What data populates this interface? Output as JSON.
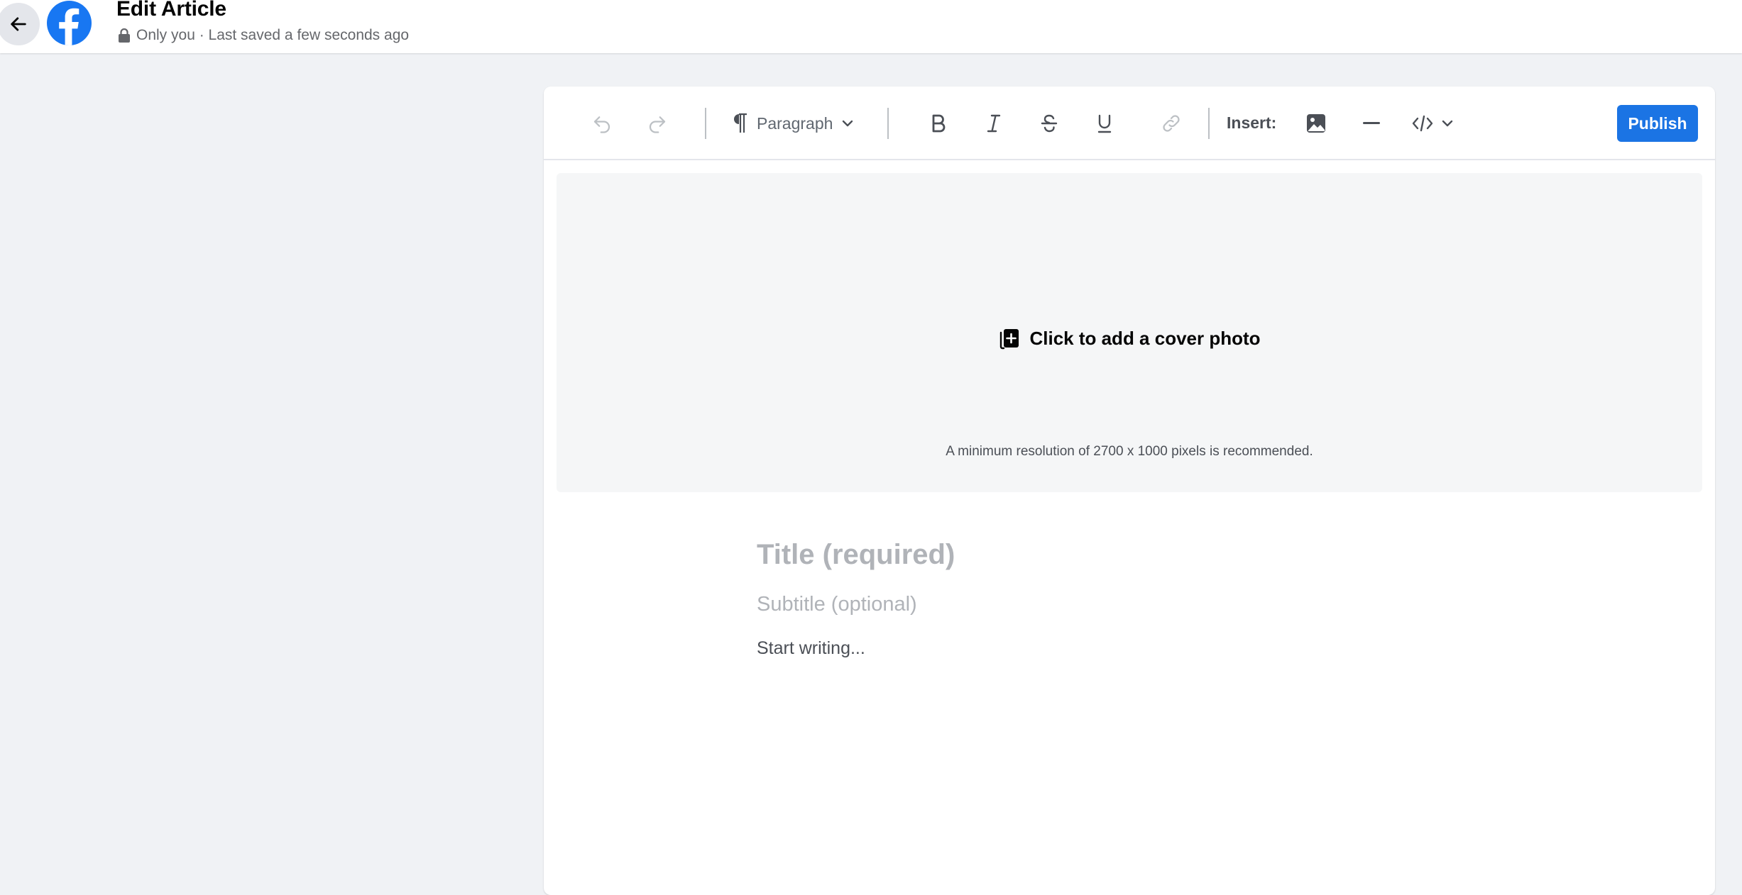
{
  "header": {
    "title": "Edit Article",
    "privacy_text": "Only you · Last saved a few seconds ago",
    "back_icon": "arrow-left-icon",
    "logo_icon": "facebook-logo-icon",
    "privacy_icon": "lock-icon"
  },
  "toolbar": {
    "undo_icon": "undo-icon",
    "redo_icon": "redo-icon",
    "block_style": {
      "icon": "paragraph-icon",
      "selected": "Paragraph"
    },
    "format_icons": [
      "bold-icon",
      "italic-icon",
      "strikethrough-icon",
      "underline-icon",
      "link-icon"
    ],
    "insert_label": "Insert:",
    "insert_icons": [
      "image-icon",
      "divider-icon",
      "embed-code-icon"
    ],
    "publish_label": "Publish"
  },
  "cover": {
    "label": "Click to add a cover photo",
    "hint": "A minimum resolution of 2700 x 1000 pixels is recommended.",
    "icon": "add-photo-icon"
  },
  "article": {
    "title_placeholder": "Title (required)",
    "subtitle_placeholder": "Subtitle (optional)",
    "body_placeholder": "Start writing..."
  },
  "colors": {
    "accent": "#1b74e4",
    "facebook_blue": "#1877f2",
    "page_background": "#f0f2f5",
    "placeholder_gray": "#b0b3b8"
  }
}
